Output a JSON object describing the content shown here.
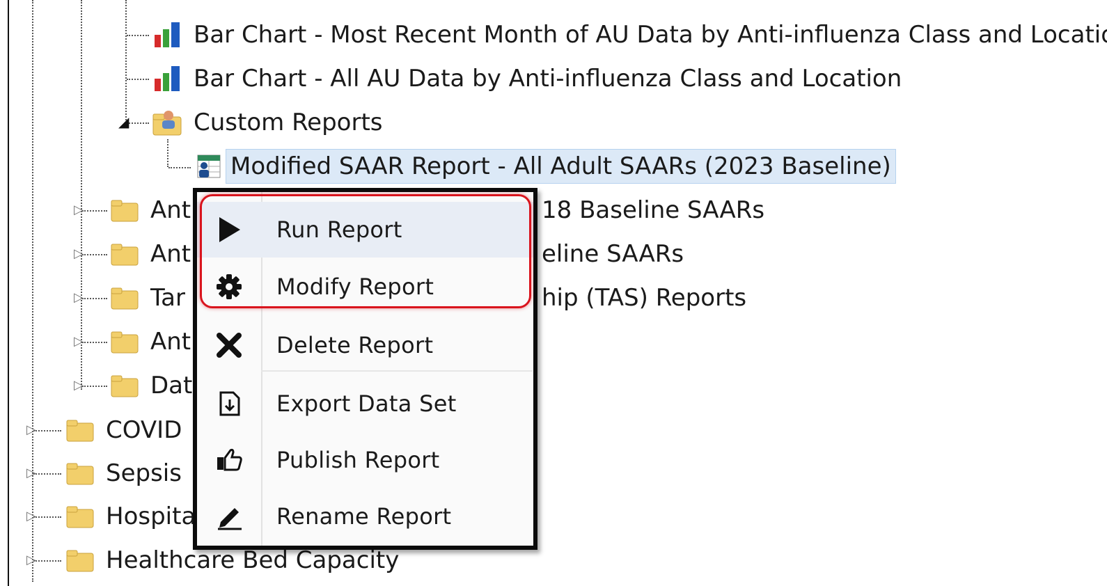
{
  "tree": {
    "items": [
      {
        "label": "Bar Chart - Most Recent Month of AU Data by Anti-influenza Class and Location",
        "icon": "bar-chart-icon"
      },
      {
        "label": "Bar Chart - All AU Data by Anti-influenza Class and Location",
        "icon": "bar-chart-icon"
      },
      {
        "label": "Custom Reports",
        "icon": "folder-user-icon"
      },
      {
        "label": "Modified SAAR Report - All Adult SAARs (2023 Baseline)",
        "icon": "report-table-icon"
      },
      {
        "label": "Ant",
        "hidden_suffix": "18 Baseline SAARs",
        "icon": "folder-icon"
      },
      {
        "label": "Ant",
        "hidden_suffix": "eline SAARs",
        "icon": "folder-icon"
      },
      {
        "label": "Tar",
        "hidden_suffix": "hip (TAS) Reports",
        "icon": "folder-icon"
      },
      {
        "label": "Ant",
        "icon": "folder-icon"
      },
      {
        "label": "Dat",
        "icon": "folder-icon"
      },
      {
        "label": "COVID",
        "icon": "folder-icon"
      },
      {
        "label": "Sepsis",
        "icon": "folder-icon"
      },
      {
        "label": "Hospita",
        "icon": "folder-icon"
      },
      {
        "label": "Healthcare Bed Capacity",
        "icon": "folder-icon"
      }
    ]
  },
  "context_menu": {
    "items": [
      {
        "label": "Run Report",
        "icon": "play-icon"
      },
      {
        "label": "Modify Report",
        "icon": "gear-icon"
      },
      {
        "label": "Delete Report",
        "icon": "close-icon"
      },
      {
        "label": "Export Data Set",
        "icon": "export-icon"
      },
      {
        "label": "Publish Report",
        "icon": "thumbs-up-icon"
      },
      {
        "label": "Rename Report",
        "icon": "pencil-icon"
      }
    ]
  },
  "colors": {
    "selection_bg": "#dce9f7",
    "highlight_border": "#d9141d",
    "folder": "#f2cf6b"
  }
}
